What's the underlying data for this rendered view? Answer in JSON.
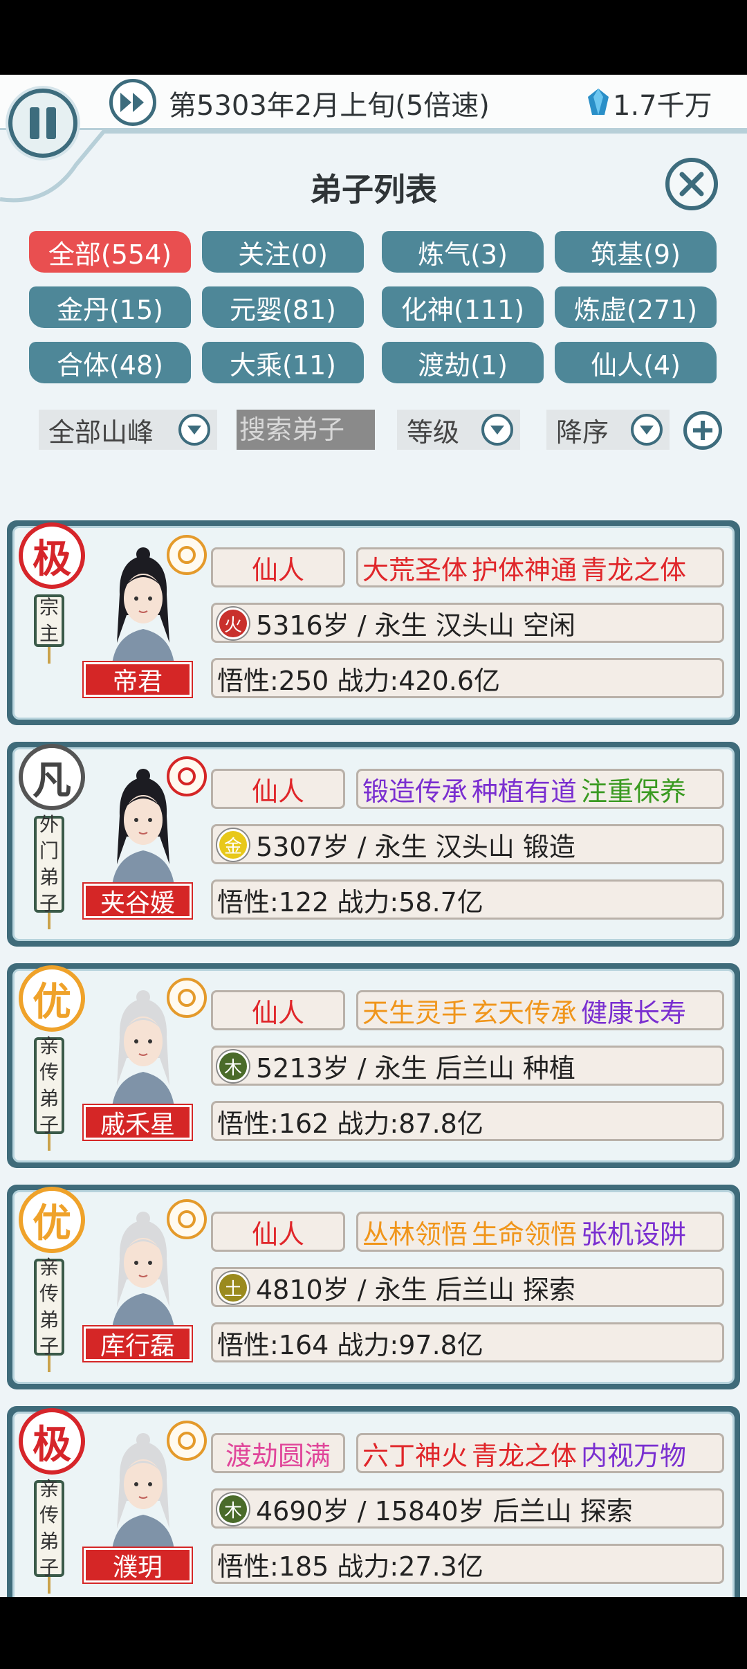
{
  "header": {
    "date": "第5303年2月上旬(5倍速)",
    "currency": "1.7千万"
  },
  "title": "弟子列表",
  "tabs": [
    {
      "label": "全部(554)",
      "active": true
    },
    {
      "label": "关注(0)"
    },
    {
      "label": "炼气(3)"
    },
    {
      "label": "筑基(9)"
    },
    {
      "label": "金丹(15)"
    },
    {
      "label": "元婴(81)"
    },
    {
      "label": "化神(111)"
    },
    {
      "label": "炼虚(271)"
    },
    {
      "label": "合体(48)"
    },
    {
      "label": "大乘(11)"
    },
    {
      "label": "渡劫(1)"
    },
    {
      "label": "仙人(4)"
    }
  ],
  "filters": {
    "peak": "全部山峰",
    "search_placeholder": "搜索弟子",
    "sort_by": "等级",
    "order": "降序"
  },
  "disciples": [
    {
      "grade": "极",
      "role": [
        "宗",
        "主"
      ],
      "name": "帝君",
      "realm": "仙人",
      "traits": [
        {
          "text": "大荒圣体",
          "color": "red"
        },
        {
          "text": "护体神通",
          "color": "red"
        },
        {
          "text": "青龙之体",
          "color": "red"
        }
      ],
      "element": "火",
      "element_color": "#c9302c",
      "info": "5316岁 / 永生  汉头山  空闲",
      "stats": "悟性:250  战力:420.6亿"
    },
    {
      "grade": "凡",
      "role": [
        "外",
        "门",
        "弟",
        "子"
      ],
      "name": "夹谷媛",
      "realm": "仙人",
      "traits": [
        {
          "text": "锻造传承",
          "color": "purple"
        },
        {
          "text": "种植有道",
          "color": "purple"
        },
        {
          "text": "注重保养",
          "color": "green"
        }
      ],
      "element": "金",
      "element_color": "#e8c81a",
      "info": "5307岁 / 永生  汉头山  锻造",
      "stats": "悟性:122  战力:58.7亿"
    },
    {
      "grade": "优",
      "role": [
        "亲",
        "传",
        "弟",
        "子"
      ],
      "name": "戚禾星",
      "realm": "仙人",
      "traits": [
        {
          "text": "天生灵手",
          "color": "orange"
        },
        {
          "text": "玄天传承",
          "color": "orange"
        },
        {
          "text": "健康长寿",
          "color": "purple"
        }
      ],
      "element": "木",
      "element_color": "#4a6b2a",
      "info": "5213岁 / 永生  后兰山  种植",
      "stats": "悟性:162  战力:87.8亿"
    },
    {
      "grade": "优",
      "role": [
        "亲",
        "传",
        "弟",
        "子"
      ],
      "name": "库行磊",
      "realm": "仙人",
      "traits": [
        {
          "text": "丛林领悟",
          "color": "orange"
        },
        {
          "text": "生命领悟",
          "color": "orange"
        },
        {
          "text": "张机设阱",
          "color": "purple"
        }
      ],
      "element": "土",
      "element_color": "#9a8a1e",
      "info": "4810岁 / 永生  后兰山  探索",
      "stats": "悟性:164  战力:97.8亿"
    },
    {
      "grade": "极",
      "role": [
        "亲",
        "传",
        "弟",
        "子"
      ],
      "name": "濮玥",
      "realm": "渡劫圆满",
      "traits": [
        {
          "text": "六丁神火",
          "color": "red"
        },
        {
          "text": "青龙之体",
          "color": "red"
        },
        {
          "text": "内视万物",
          "color": "purple"
        }
      ],
      "element": "木",
      "element_color": "#4a6b2a",
      "info": "4690岁 / 15840岁  后兰山  探索",
      "stats": "悟性:185  战力:27.3亿"
    }
  ]
}
